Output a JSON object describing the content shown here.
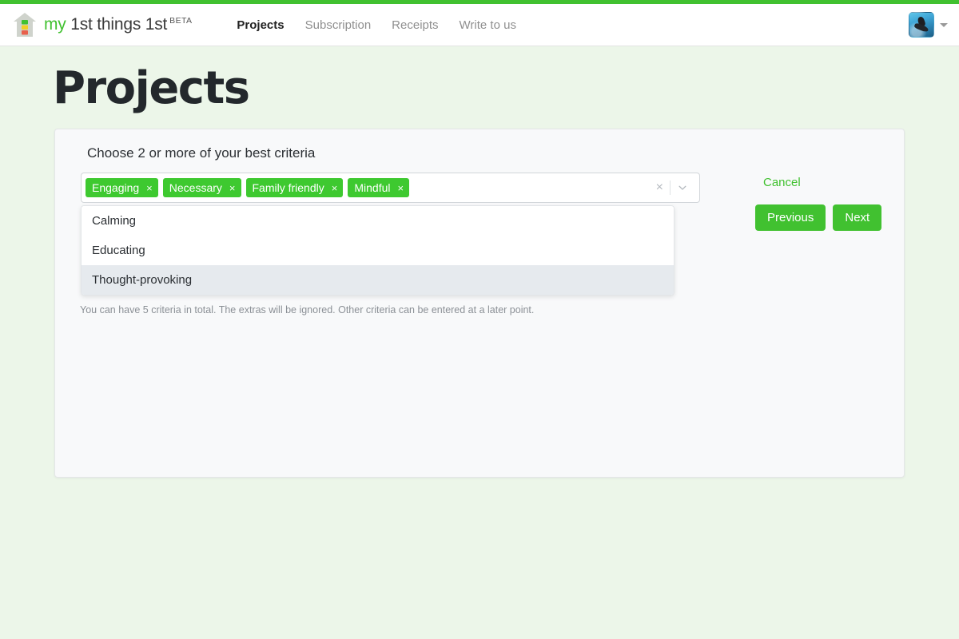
{
  "brand": {
    "my": "my",
    "name": "1st things 1st",
    "beta": "BETA",
    "logo_icon": "house-logo-icon"
  },
  "nav": {
    "links": [
      {
        "label": "Projects",
        "active": true
      },
      {
        "label": "Subscription",
        "active": false
      },
      {
        "label": "Receipts",
        "active": false
      },
      {
        "label": "Write to us",
        "active": false
      }
    ],
    "avatar_icon": "user-avatar",
    "caret_icon": "chevron-down-icon"
  },
  "page": {
    "title": "Projects"
  },
  "form": {
    "label": "Choose 2 or more of your best criteria",
    "help_text": "You can have 5 criteria in total. The extras will be ignored. Other criteria can be entered at a later point.",
    "selected_tags": [
      {
        "label": "Engaging",
        "remove": "×"
      },
      {
        "label": "Necessary",
        "remove": "×"
      },
      {
        "label": "Family friendly",
        "remove": "×"
      },
      {
        "label": "Mindful",
        "remove": "×"
      }
    ],
    "clear_icon": "×",
    "dropdown_icon": "chevron-down-icon",
    "menu_options": [
      {
        "label": "Calming",
        "focused": false
      },
      {
        "label": "Educating",
        "focused": false
      },
      {
        "label": "Thought-provoking",
        "focused": true
      }
    ]
  },
  "actions": {
    "cancel": "Cancel",
    "previous": "Previous",
    "next": "Next"
  },
  "colors": {
    "accent_green": "#41c130",
    "tag_green": "#3ec930",
    "page_background": "#ecf6e9",
    "card_background": "#f8f9fa",
    "option_highlight": "#e6eaee"
  }
}
